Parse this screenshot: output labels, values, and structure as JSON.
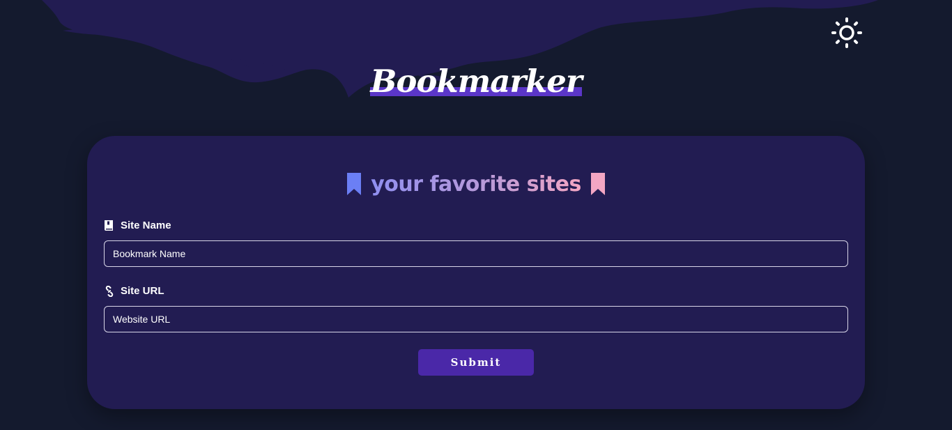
{
  "header": {
    "logo_text": "Bookmarker",
    "theme_toggle_icon": "sun-icon"
  },
  "form": {
    "title": "your favorite sites",
    "title_icon_left": "bookmark-icon",
    "title_icon_right": "bookmark-icon",
    "site_name": {
      "label": "Site Name",
      "icon": "book-icon",
      "placeholder": "Bookmark Name",
      "value": ""
    },
    "site_url": {
      "label": "Site URL",
      "icon": "link-icon",
      "placeholder": "Website URL",
      "value": ""
    },
    "submit_label": "Submit"
  },
  "colors": {
    "background": "#141a2e",
    "card": "#221c52",
    "accent": "#4a28a8",
    "bookmark_left": "#6b7ff5",
    "bookmark_right": "#f3a6c3"
  }
}
